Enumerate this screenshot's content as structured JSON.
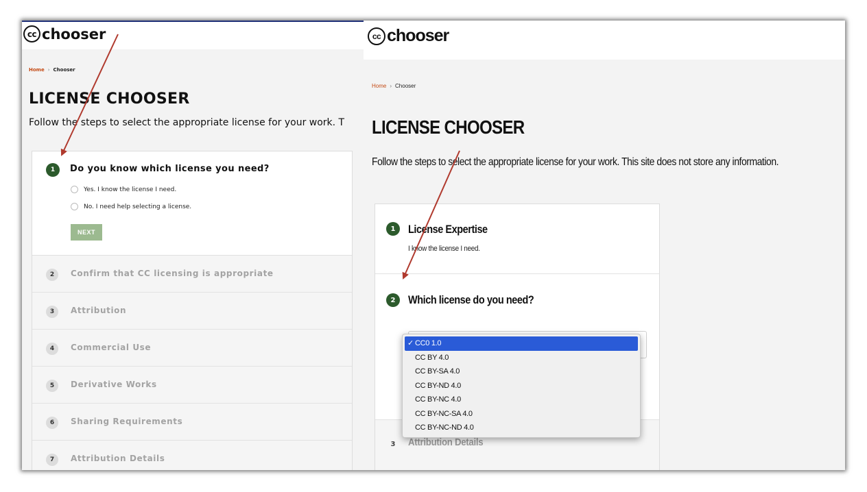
{
  "left": {
    "logo": {
      "cc": "cc",
      "text": "chooser"
    },
    "breadcrumb": {
      "home": "Home",
      "separator": "›",
      "current": "Chooser"
    },
    "title": "LICENSE CHOOSER",
    "subtitle": "Follow the steps to select the appropriate license for your work. T",
    "active_step": {
      "number": "1",
      "question": "Do you know which license you need?",
      "options": [
        "Yes. I know the license I need.",
        "No. I need help selecting a license."
      ],
      "next_label": "NEXT"
    },
    "steps": [
      {
        "number": "2",
        "label": "Confirm that CC licensing is appropriate"
      },
      {
        "number": "3",
        "label": "Attribution"
      },
      {
        "number": "4",
        "label": "Commercial Use"
      },
      {
        "number": "5",
        "label": "Derivative Works"
      },
      {
        "number": "6",
        "label": "Sharing Requirements"
      },
      {
        "number": "7",
        "label": "Attribution Details"
      }
    ]
  },
  "right": {
    "logo": {
      "cc": "cc",
      "text": "chooser"
    },
    "breadcrumb": {
      "home": "Home",
      "separator": "›",
      "current": "Chooser"
    },
    "title": "LICENSE CHOOSER",
    "subtitle": "Follow the steps to select the appropriate license for your work. This site does not store any information.",
    "step1": {
      "number": "1",
      "title": "License Expertise",
      "answer": "I know the license I need."
    },
    "step2": {
      "number": "2",
      "title": "Which license do you need?"
    },
    "step3": {
      "number": "3",
      "title": "Attribution Details"
    },
    "dropdown": {
      "selected": "CC0 1.0",
      "check": "✓",
      "options": [
        "CC0 1.0",
        "CC BY 4.0",
        "CC BY-SA 4.0",
        "CC BY-ND 4.0",
        "CC BY-NC 4.0",
        "CC BY-NC-SA 4.0",
        "CC BY-NC-ND 4.0"
      ]
    }
  },
  "colors": {
    "active_badge": "#2c5a2c",
    "home_link": "#c44a14",
    "next_button": "#9cba90",
    "dropdown_highlight": "#2a5bd7",
    "annotation_arrow": "#b03a2e"
  }
}
